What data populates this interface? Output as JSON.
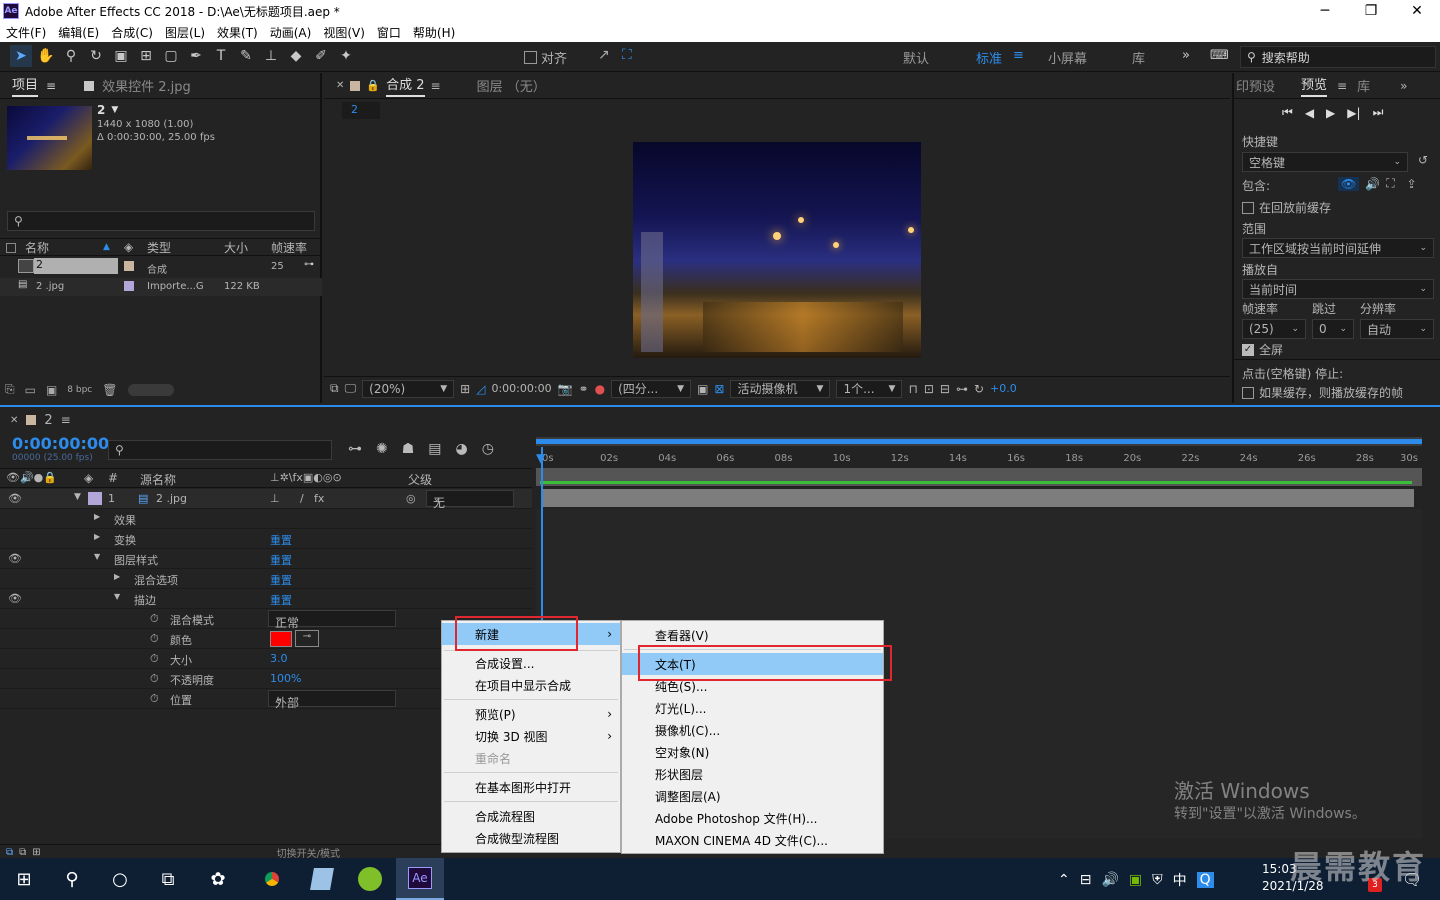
{
  "app": {
    "title": "Adobe After Effects CC 2018 - D:\\Ae\\无标题项目.aep *",
    "logo": "Ae"
  },
  "menubar": [
    "文件(F)",
    "编辑(E)",
    "合成(C)",
    "图层(L)",
    "效果(T)",
    "动画(A)",
    "视图(V)",
    "窗口",
    "帮助(H)"
  ],
  "toolbar": {
    "snap_label": "对齐",
    "workspaces": [
      "默认",
      "标准",
      "小屏幕",
      "库"
    ],
    "search_placeholder": "搜索帮助"
  },
  "project": {
    "tab": "项目",
    "effects_tab": "效果控件 2.jpg",
    "item_name": "2",
    "item_info1": "1440 x 1080 (1.00)",
    "item_info2": "Δ 0:00:30:00, 25.00 fps",
    "search_placeholder": "",
    "columns": [
      "名称",
      "类型",
      "大小",
      "帧速率"
    ],
    "rows": [
      {
        "name": "2",
        "type": "合成",
        "size": "",
        "fps": "25"
      },
      {
        "name": "2 .jpg",
        "type": "Importe...G",
        "size": "122 KB",
        "fps": ""
      }
    ],
    "bpc": "8 bpc"
  },
  "comp": {
    "tab": "合成 2",
    "layer_tab": "图层 （无）",
    "breadcrumb": "2",
    "zoom": "(20%)",
    "timecode": "0:00:00:00",
    "resolution": "(四分...",
    "camera": "活动摄像机",
    "views": "1个...",
    "exposure": "+0.0"
  },
  "preview": {
    "tab0": "印预设",
    "tab1": "预览",
    "tab2": "库",
    "shortcut_label": "快捷键",
    "shortcut_value": "空格键",
    "include_label": "包含:",
    "cache_label": "在回放前缓存",
    "range_label": "范围",
    "range_value": "工作区域按当前时间延伸",
    "play_from_label": "播放自",
    "play_from_value": "当前时间",
    "fps_label": "帧速率",
    "skip_label": "跳过",
    "res_label": "分辨率",
    "fps_value": "(25)",
    "skip_value": "0",
    "res_value": "自动",
    "fullscreen_label": "全屏",
    "stop_label": "点击(空格键) 停止:",
    "if_cache_label": "如果缓存，则播放缓存的帧"
  },
  "timeline": {
    "tab": "2",
    "timecode": "0:00:00:00",
    "timecode_sub": "00000 (25.00 fps)",
    "col_source": "源名称",
    "col_parent": "父级",
    "layer_num": "1",
    "layer_name": "2 .jpg",
    "parent_value": "无",
    "ruler": [
      "0s",
      "02s",
      "04s",
      "06s",
      "08s",
      "10s",
      "12s",
      "14s",
      "16s",
      "18s",
      "20s",
      "22s",
      "24s",
      "26s",
      "28s",
      "30s"
    ],
    "props": [
      {
        "label": "效果",
        "value": ""
      },
      {
        "label": "变换",
        "value": "重置"
      },
      {
        "label": "图层样式",
        "value": "重置"
      },
      {
        "label": "混合选项",
        "value": "重置"
      },
      {
        "label": "描边",
        "value": "重置"
      },
      {
        "label": "混合模式",
        "value": "正常"
      },
      {
        "label": "颜色",
        "value": ""
      },
      {
        "label": "大小",
        "value": "3.0"
      },
      {
        "label": "不透明度",
        "value": "100%"
      },
      {
        "label": "位置",
        "value": "外部"
      }
    ],
    "footer": "切换开关/模式",
    "stroke_color": "#ff0000"
  },
  "context_menu": {
    "items": [
      "新建",
      "合成设置...",
      "在项目中显示合成",
      "预览(P)",
      "切换 3D 视图",
      "重命名",
      "在基本图形中打开",
      "合成流程图",
      "合成微型流程图"
    ]
  },
  "submenu": {
    "items": [
      "查看器(V)",
      "文本(T)",
      "纯色(S)...",
      "灯光(L)...",
      "摄像机(C)...",
      "空对象(N)",
      "形状图层",
      "调整图层(A)",
      "Adobe Photoshop 文件(H)...",
      "MAXON CINEMA 4D 文件(C)..."
    ]
  },
  "watermark": {
    "line1": "激活 Windows",
    "line2": "转到\"设置\"以激活 Windows。"
  },
  "brand": "晨需教育",
  "taskbar": {
    "time": "15:03",
    "date": "2021/1/28",
    "lang": "中",
    "badge": "3",
    "ae": "Ae"
  }
}
